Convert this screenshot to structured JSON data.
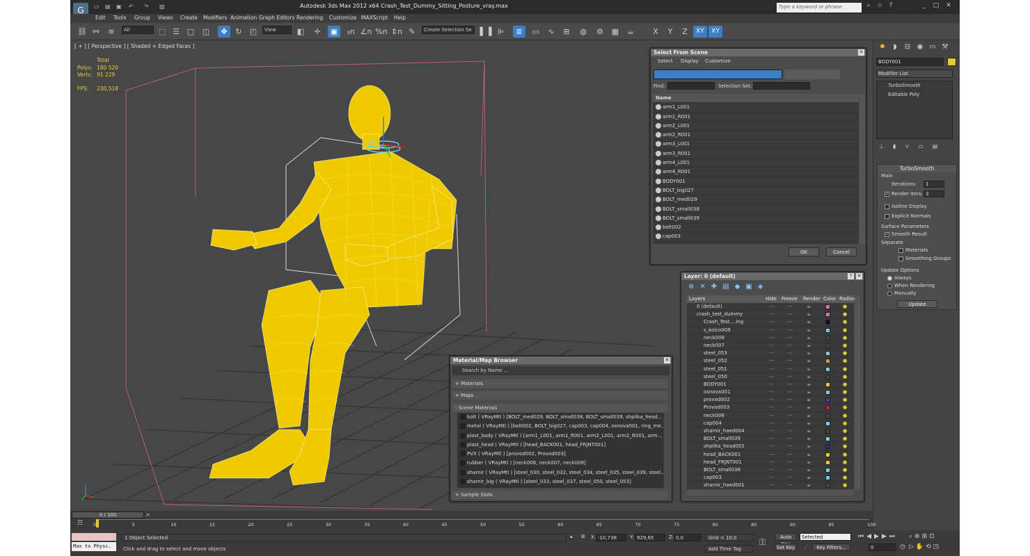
{
  "window": {
    "title": "Autodesk 3ds Max  2012 x64    Crash_Test_Dummy_Sitting_Posture_vray.max",
    "search_placeholder": "Type a keyword or phrase"
  },
  "menu": [
    "Edit",
    "Tools",
    "Group",
    "Views",
    "Create",
    "Modifiers",
    "Animation",
    "Graph Editors",
    "Rendering",
    "Customize",
    "MAXScript",
    "Help"
  ],
  "toolbar": {
    "filter": "All",
    "refcoord": "View",
    "selset": "Create Selection Se",
    "axes": [
      "X",
      "Y",
      "Z",
      "XY",
      "XY"
    ]
  },
  "viewport": {
    "label": "[ + ] [ Perspective ] [ Shaded + Edged Faces ]",
    "stats": {
      "total_label": "Total",
      "polys_label": "Polys:",
      "polys": "180 520",
      "verts_label": "Verts:",
      "verts": "91 229",
      "fps_label": "FPS:",
      "fps": "230,518"
    }
  },
  "command_panel": {
    "object_name": "BODY001",
    "modifier_list": "Modifier List",
    "stack": [
      "TurboSmooth",
      "Editable Poly"
    ],
    "turbosmooth": {
      "title": "TurboSmooth",
      "main": "Main",
      "iterations_label": "Iterations:",
      "iterations": "1",
      "render_iters_label": "Render Iters:",
      "render_iters": "3",
      "isoline": "Isoline Display",
      "explicit": "Explicit Normals",
      "surface_params": "Surface Parameters",
      "smooth_result": "Smooth Result",
      "separate": "Separate",
      "materials": "Materials",
      "smoothing_groups": "Smoothing Groups",
      "update_options": "Update Options",
      "always": "Always",
      "when_rendering": "When Rendering",
      "manually": "Manually",
      "update_btn": "Update"
    }
  },
  "select_from_scene": {
    "title": "Select From Scene",
    "menu": [
      "Select",
      "Display",
      "Customize"
    ],
    "find_label": "Find:",
    "selset_label": "Selection Set:",
    "col_name": "Name",
    "items": [
      "arm1_L001",
      "arm1_R001",
      "arm2_L001",
      "arm2_R001",
      "arm3_L001",
      "arm3_R001",
      "arm4_L001",
      "arm4_R001",
      "BODY001",
      "BOLT_big027",
      "BOLT_med029",
      "BOLT_small038",
      "BOLT_small039",
      "bolt002",
      "cap003"
    ],
    "ok": "OK",
    "cancel": "Cancel"
  },
  "layer_dialog": {
    "title": "Layer: 0 (default)",
    "columns": [
      "Layers",
      "Hide",
      "Freeze",
      "Render",
      "Color",
      "Radios"
    ],
    "rows": [
      {
        "name": "0 (default)",
        "indent": 0,
        "color": "#e86fb0"
      },
      {
        "name": "crash_test_dummy",
        "indent": 0,
        "color": "#e86fb0"
      },
      {
        "name": "Crash_Test....ing",
        "indent": 2,
        "color": "#111111"
      },
      {
        "name": "s_kolco009",
        "indent": 2,
        "color": "#7fc7e6"
      },
      {
        "name": "neck008",
        "indent": 2,
        "color": "#444444"
      },
      {
        "name": "neck007",
        "indent": 2,
        "color": "#444444"
      },
      {
        "name": "steel_053",
        "indent": 2,
        "color": "#7fc7e6"
      },
      {
        "name": "steel_052",
        "indent": 2,
        "color": "#c9a020"
      },
      {
        "name": "steel_051",
        "indent": 2,
        "color": "#7fc7e6"
      },
      {
        "name": "steel_050",
        "indent": 2,
        "color": "#444444"
      },
      {
        "name": "BODY001",
        "indent": 2,
        "color": "#e6c830"
      },
      {
        "name": "osnova001",
        "indent": 2,
        "color": "#7fc7e6"
      },
      {
        "name": "provod002",
        "indent": 2,
        "color": "#6a2a9a"
      },
      {
        "name": "Provod003",
        "indent": 2,
        "color": "#c02040"
      },
      {
        "name": "neck006",
        "indent": 2,
        "color": "#444444"
      },
      {
        "name": "cap004",
        "indent": 2,
        "color": "#7fc7e6"
      },
      {
        "name": "sharnir_haed004",
        "indent": 2,
        "color": "#444444"
      },
      {
        "name": "BOLT_small039",
        "indent": 2,
        "color": "#7fc7e6"
      },
      {
        "name": "shpilka_head001",
        "indent": 2,
        "color": "#20308a"
      },
      {
        "name": "head_BACK001",
        "indent": 2,
        "color": "#e6c830"
      },
      {
        "name": "head_FRJNT001",
        "indent": 2,
        "color": "#e6c830"
      },
      {
        "name": "BOLT_small038",
        "indent": 2,
        "color": "#7fc7e6"
      },
      {
        "name": "cap003",
        "indent": 2,
        "color": "#7fc7e6"
      },
      {
        "name": "sharnir_haed001",
        "indent": 2,
        "color": "#444444"
      }
    ]
  },
  "material_browser": {
    "title": "Material/Map Browser",
    "search": "Search by Name ...",
    "groups": [
      "+ Materials",
      "+ Maps",
      "- Scene Materials"
    ],
    "materials": [
      "bolt  ( VRayMtl )  [BOLT_med029, BOLT_small038, BOLT_small039, shpilka_head...",
      "metal  ( VRayMtl )  [bolt002, BOLT_big027, cap003, cap004, osnova001, ring_me...",
      "plast_body  ( VRayMtl )  [arm1_L001, arm1_R001, arm2_L001, arm2_R001, arm...",
      "plast_head  ( VRayMtl )  [head_BACK001, head_FRJNT001]",
      "PVX  ( VRayMtl )  [provod002, Provod003]",
      "rubber  ( VRayMtl )  [neck006, neck007, neck008]",
      "sharnir  ( VRayMtl )  [steel_030, steel_032, steel_034, steel_035, steel_039, steel...",
      "sharnir_big  ( VRayMtl )  [steel_033, steel_037, steel_050, steel_053]"
    ],
    "sample_slots": "+ Sample Slots"
  },
  "timeline": {
    "frame": "0 / 100",
    "ticks": [
      "0",
      "5",
      "10",
      "15",
      "20",
      "25",
      "30",
      "35",
      "40",
      "45",
      "50",
      "55",
      "60",
      "65",
      "70",
      "75",
      "80",
      "85",
      "90",
      "95",
      "100"
    ]
  },
  "statusbar": {
    "maxscript": "Max to Physc.",
    "selected": "1 Object Selected",
    "prompt": "Click and drag to select and move objects",
    "x_label": "X:",
    "x": "-10,738",
    "y_label": "Y:",
    "y": "929,65",
    "z_label": "Z:",
    "z": "0,0",
    "grid": "Grid = 10,0",
    "add_time_tag": "Add Time Tag",
    "auto_key": "Auto Key",
    "set_key": "Set Key",
    "key_mode": "Selected",
    "key_filters": "Key Filters...",
    "frame": "0"
  }
}
